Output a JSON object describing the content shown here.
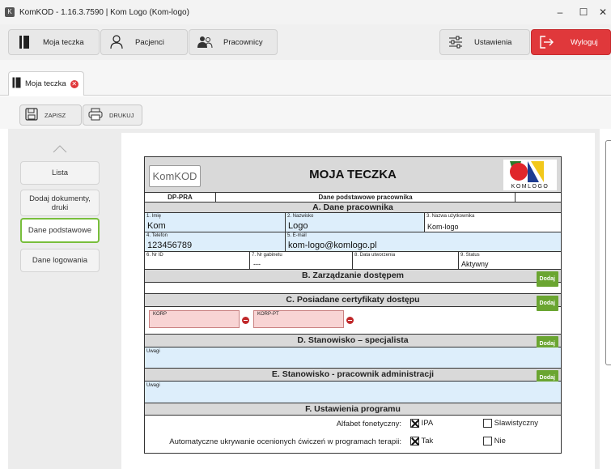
{
  "window": {
    "title": "KomKOD - 1.16.3.7590 | Kom Logo (Kom-logo)",
    "app_icon": "K"
  },
  "nav": {
    "moja_teczka": "Moja teczka",
    "pacjenci": "Pacjenci",
    "pracownicy": "Pracownicy",
    "ustawienia": "Ustawienia",
    "wyloguj": "Wyloguj"
  },
  "tab": {
    "label": "Moja teczka"
  },
  "actions": {
    "zapisz": "ZAPISZ",
    "drukuj": "DRUKUJ"
  },
  "sidebar": {
    "items": [
      {
        "label": "Lista"
      },
      {
        "label": "Dodaj dokumenty, druki"
      },
      {
        "label": "Dane podstawowe"
      },
      {
        "label": "Dane logowania"
      }
    ]
  },
  "form": {
    "logo_text": "KomKOD",
    "title": "MOJA TECZKA",
    "komlogo_text": "KOMLOGO",
    "code": "DP-PRA",
    "subtitle": "Dane podstawowe pracownika",
    "section_a": "A. Dane pracownika",
    "fields": {
      "imie_label": "1. Imię",
      "imie": "Kom",
      "nazwisko_label": "2. Nazwisko",
      "nazwisko": "Logo",
      "uzytkownik_label": "3. Nazwa użytkownika",
      "uzytkownik": "Kom-logo",
      "telefon_label": "4. Telefon",
      "telefon": "123456789",
      "email_label": "5. E-mail",
      "email": "kom-logo@komlogo.pl",
      "nrid_label": "6. Nr ID",
      "nrid": "",
      "gabinet_label": "7. Nr gabinetu",
      "gabinet": "---",
      "data_label": "8. Data utworzenia",
      "data": "",
      "status_label": "9. Status",
      "status": "Aktywny"
    },
    "section_b": "B. Zarządzanie dostępem",
    "section_c": "C. Posiadane certyfikaty dostępu",
    "certs": [
      "KORP",
      "KORP-PT"
    ],
    "section_d": "D. Stanowisko – specjalista",
    "uwagi_d": "Uwagi",
    "section_e": "E. Stanowisko - pracownik administracji",
    "uwagi_e": "Uwagi",
    "section_f": "F. Ustawienia programu",
    "dodaj": "Dodaj",
    "settings": {
      "alfabet_label": "Alfabet fonetyczny:",
      "alfabet_opt1": "IPA",
      "alfabet_opt1_checked": true,
      "alfabet_opt2": "Slawistyczny",
      "alfabet_opt2_checked": false,
      "auto_label": "Automatyczne ukrywanie ocenionych ćwiczeń w programach terapii:",
      "auto_opt1": "Tak",
      "auto_opt1_checked": true,
      "auto_opt2": "Nie",
      "auto_opt2_checked": false
    }
  },
  "colors": {
    "logout": "#e0383b",
    "active_border": "#78be3c",
    "dodaj": "#6aa531",
    "field_bg": "#ddeefb",
    "cert_bg": "#f8d4d4"
  }
}
